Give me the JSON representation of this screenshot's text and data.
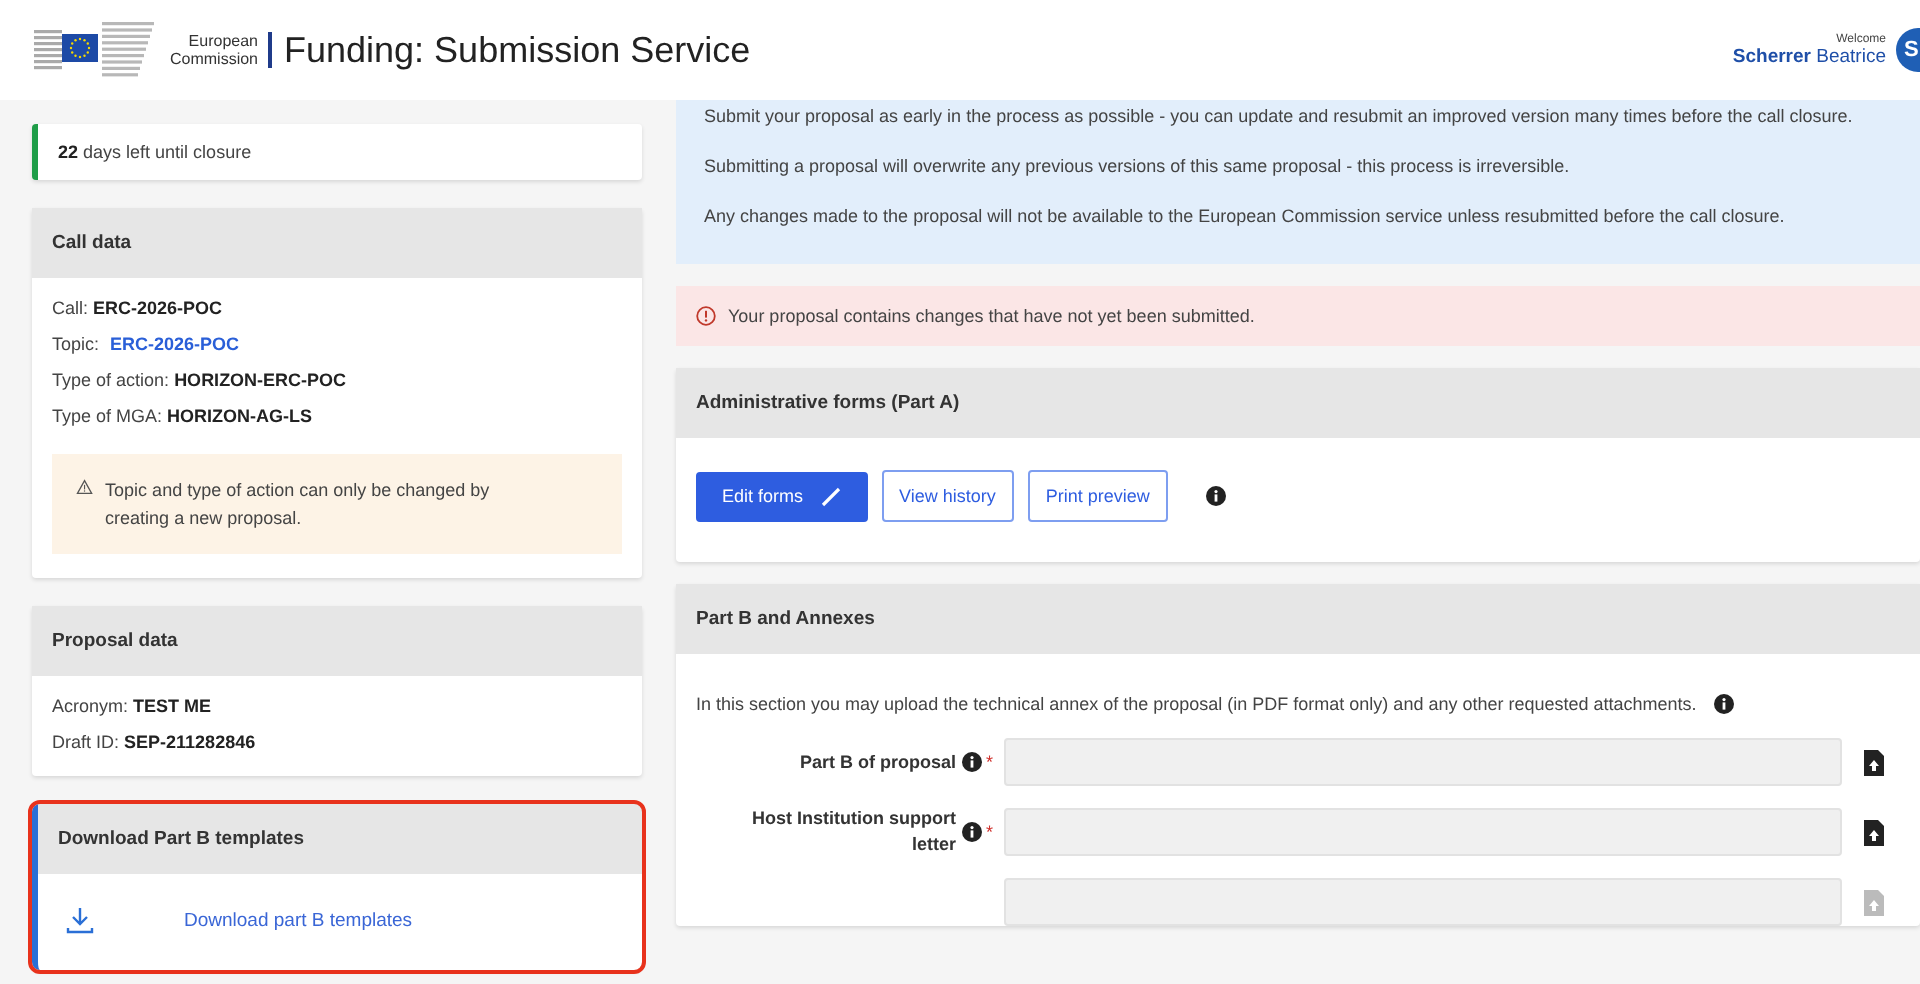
{
  "header": {
    "brand": "European Commission",
    "title": "Funding: Submission Service",
    "welcome": "Welcome",
    "user_last": "Scherrer",
    "user_first": "Beatrice",
    "avatar": "S"
  },
  "deadline": {
    "days": "22",
    "text": "days left until closure"
  },
  "call_data": {
    "title": "Call data",
    "rows": [
      {
        "label": "Call:",
        "value": "ERC-2026-POC",
        "kind": "text"
      },
      {
        "label": "Topic:",
        "value": "ERC-2026-POC",
        "kind": "link"
      },
      {
        "label": "Type of action:",
        "value": "HORIZON-ERC-POC",
        "kind": "text"
      },
      {
        "label": "Type of MGA:",
        "value": "HORIZON-AG-LS",
        "kind": "text"
      }
    ],
    "warning": "Topic and type of action can only be changed by creating a new proposal."
  },
  "proposal_data": {
    "title": "Proposal data",
    "rows": [
      {
        "label": "Acronym:",
        "value": "TEST ME",
        "kind": "text"
      },
      {
        "label": "Draft ID:",
        "value": "SEP-211282846",
        "kind": "text"
      }
    ]
  },
  "templates": {
    "title": "Download Part B templates",
    "link": "Download part B templates",
    "highlighted": true
  },
  "info": [
    "Submit your proposal as early in the process as possible - you can update and resubmit an improved version many times before the call closure.",
    "Submitting a proposal will overwrite any previous versions of this same proposal - this process is irreversible.",
    "Any changes made to the proposal will not be available to the European Commission service unless resubmitted before the call closure."
  ],
  "alert": "Your proposal contains changes that have not yet been submitted.",
  "admin_forms": {
    "title": "Administrative forms (Part A)",
    "buttons": [
      {
        "label": "Edit forms",
        "kind": "primary"
      },
      {
        "label": "View history",
        "kind": "outline"
      },
      {
        "label": "Print preview",
        "kind": "outline"
      }
    ]
  },
  "part_b": {
    "title": "Part B and Annexes",
    "intro": "In this section you may upload the technical annex of the proposal (in PDF format only) and any other requested attachments.",
    "fields": [
      {
        "label": "Part B of proposal",
        "required": true,
        "required_mark": "*"
      },
      {
        "label": "Host Institution support letter",
        "required": true,
        "required_mark": "*"
      },
      {
        "required": false
      }
    ]
  }
}
